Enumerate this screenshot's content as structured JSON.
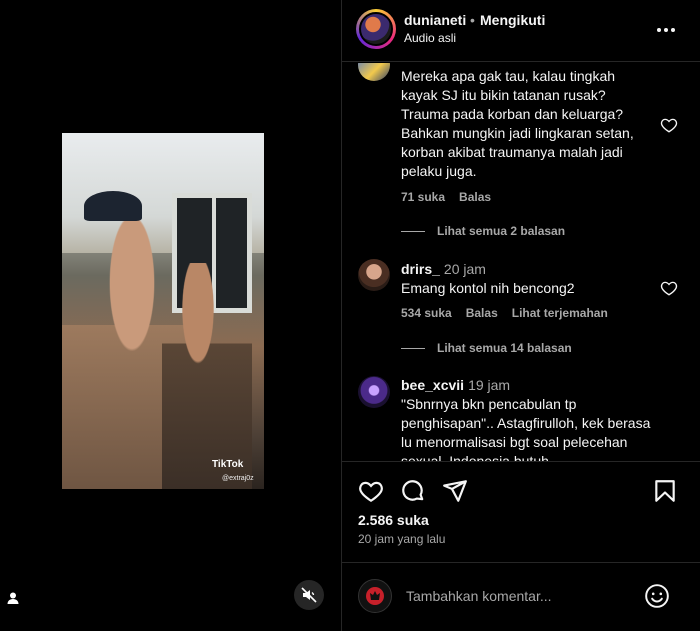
{
  "post": {
    "username": "dunianeti",
    "separator": "•",
    "follow_label": "Mengikuti",
    "audio_label": "Audio asli",
    "likes": "2.586 suka",
    "time_ago": "20 jam yang lalu"
  },
  "video": {
    "watermark": "TikTok",
    "watermark_handle": "@extraj0z"
  },
  "comments": [
    {
      "text": "Mereka apa gak tau, kalau tingkah kayak SJ itu bikin tatanan rusak? Trauma pada korban dan keluarga? Bahkan mungkin jadi lingkaran setan, korban akibat traumanya malah jadi pelaku juga.",
      "likes": "71 suka",
      "reply_label": "Balas",
      "view_replies": "Lihat semua 2 balasan"
    },
    {
      "user": "drirs_",
      "time": "20 jam",
      "text": "Emang kontol nih bencong2",
      "likes": "534 suka",
      "reply_label": "Balas",
      "translate_label": "Lihat terjemahan",
      "view_replies": "Lihat semua 14 balasan"
    },
    {
      "user": "bee_xcvii",
      "time": "19 jam",
      "text": "\"Sbnrnya bkn pencabulan tp penghisapan\".. Astagfirulloh, kek berasa lu menormalisasi bgt soal pelecehan sexual. Indonesia butuh"
    }
  ],
  "add_comment": {
    "placeholder": "Tambahkan komentar..."
  },
  "icons": {
    "more": "more-horizontal-icon",
    "heart": "heart-icon",
    "comment": "comment-icon",
    "share": "share-icon",
    "save": "bookmark-icon",
    "emoji": "emoji-icon",
    "mute": "speaker-muted-icon",
    "user": "user-icon"
  }
}
